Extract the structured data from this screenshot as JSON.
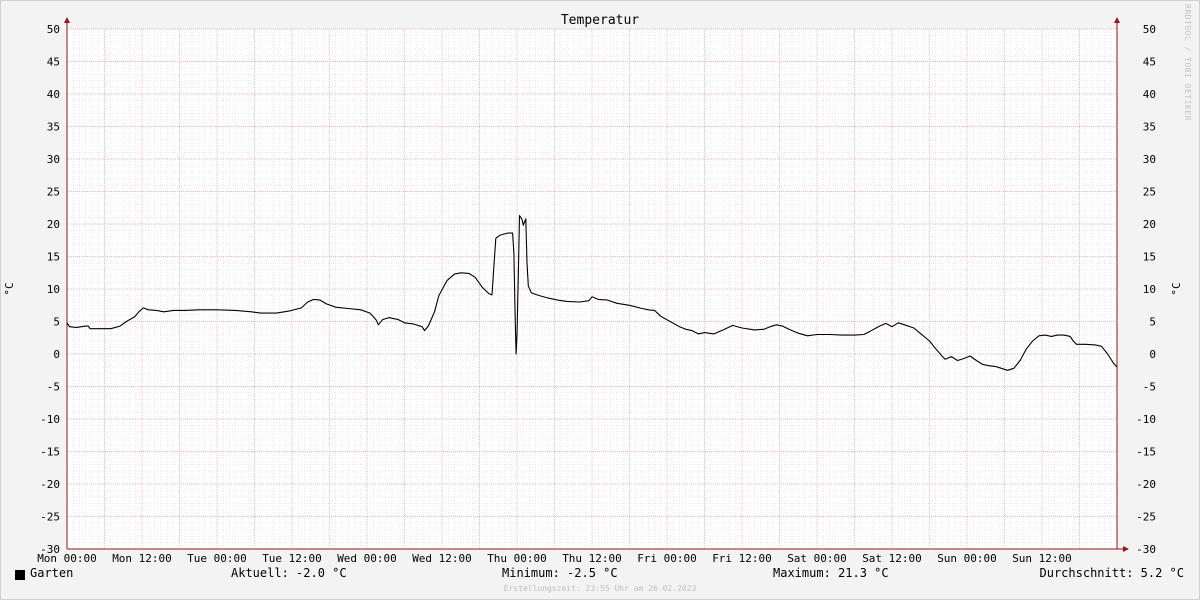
{
  "chart_data": {
    "type": "line",
    "title": "Temperatur",
    "ylabel": "°C",
    "ylim": [
      -30,
      50
    ],
    "yticks": [
      50,
      45,
      40,
      35,
      30,
      25,
      20,
      15,
      10,
      5,
      0,
      -5,
      -10,
      -15,
      -20,
      -25,
      -30
    ],
    "xlim": [
      0,
      168
    ],
    "xticks": [
      {
        "t": 0,
        "label": "Mon 00:00"
      },
      {
        "t": 12,
        "label": "Mon 12:00"
      },
      {
        "t": 24,
        "label": "Tue 00:00"
      },
      {
        "t": 36,
        "label": "Tue 12:00"
      },
      {
        "t": 48,
        "label": "Wed 00:00"
      },
      {
        "t": 60,
        "label": "Wed 12:00"
      },
      {
        "t": 72,
        "label": "Thu 00:00"
      },
      {
        "t": 84,
        "label": "Thu 12:00"
      },
      {
        "t": 96,
        "label": "Fri 00:00"
      },
      {
        "t": 108,
        "label": "Fri 12:00"
      },
      {
        "t": 120,
        "label": "Sat 00:00"
      },
      {
        "t": 132,
        "label": "Sat 12:00"
      },
      {
        "t": 144,
        "label": "Sun 00:00"
      },
      {
        "t": 156,
        "label": "Sun 12:00"
      }
    ],
    "series": [
      {
        "name": "Garten",
        "color": "#000000",
        "points": [
          [
            0,
            4.8
          ],
          [
            0.4,
            4.2
          ],
          [
            1.5,
            4.1
          ],
          [
            3,
            4.3
          ],
          [
            3.4,
            4.3
          ],
          [
            3.7,
            3.9
          ],
          [
            5,
            3.9
          ],
          [
            7,
            3.9
          ],
          [
            8.5,
            4.3
          ],
          [
            9.5,
            5.0
          ],
          [
            10.8,
            5.7
          ],
          [
            11.5,
            6.5
          ],
          [
            12.2,
            7.1
          ],
          [
            13,
            6.8
          ],
          [
            14.3,
            6.7
          ],
          [
            15.5,
            6.5
          ],
          [
            17,
            6.7
          ],
          [
            19,
            6.7
          ],
          [
            21,
            6.8
          ],
          [
            24,
            6.8
          ],
          [
            27,
            6.7
          ],
          [
            29.5,
            6.5
          ],
          [
            31,
            6.3
          ],
          [
            33.5,
            6.3
          ],
          [
            35.5,
            6.6
          ],
          [
            37.5,
            7.1
          ],
          [
            38.5,
            8.0
          ],
          [
            39.5,
            8.4
          ],
          [
            40.5,
            8.3
          ],
          [
            41.5,
            7.7
          ],
          [
            43,
            7.2
          ],
          [
            45,
            7.0
          ],
          [
            47,
            6.8
          ],
          [
            48.5,
            6.3
          ],
          [
            49.5,
            5.2
          ],
          [
            49.8,
            4.5
          ],
          [
            50.5,
            5.3
          ],
          [
            51.5,
            5.6
          ],
          [
            53,
            5.3
          ],
          [
            54,
            4.8
          ],
          [
            55.5,
            4.6
          ],
          [
            56.8,
            4.2
          ],
          [
            57.2,
            3.6
          ],
          [
            57.8,
            4.3
          ],
          [
            58.8,
            6.5
          ],
          [
            59.5,
            9.0
          ],
          [
            60.8,
            11.3
          ],
          [
            62,
            12.3
          ],
          [
            63,
            12.5
          ],
          [
            64.3,
            12.4
          ],
          [
            65.3,
            11.8
          ],
          [
            66.5,
            10.2
          ],
          [
            67.5,
            9.3
          ],
          [
            68,
            9.1
          ],
          [
            68.3,
            13.5
          ],
          [
            68.6,
            17.8
          ],
          [
            69.3,
            18.3
          ],
          [
            70.5,
            18.6
          ],
          [
            71.3,
            18.6
          ],
          [
            71.5,
            15.5
          ],
          [
            71.7,
            6.0
          ],
          [
            71.85,
            0.0
          ],
          [
            72,
            3.0
          ],
          [
            72.2,
            12.0
          ],
          [
            72.4,
            21.3
          ],
          [
            72.8,
            20.7
          ],
          [
            73,
            19.8
          ],
          [
            73.2,
            20.3
          ],
          [
            73.4,
            20.8
          ],
          [
            73.6,
            14.0
          ],
          [
            73.8,
            10.5
          ],
          [
            74.3,
            9.4
          ],
          [
            75.5,
            9.0
          ],
          [
            77,
            8.6
          ],
          [
            78.5,
            8.3
          ],
          [
            80,
            8.1
          ],
          [
            82,
            8.0
          ],
          [
            83.5,
            8.2
          ],
          [
            84,
            8.8
          ],
          [
            85,
            8.4
          ],
          [
            86.5,
            8.3
          ],
          [
            88,
            7.8
          ],
          [
            90,
            7.5
          ],
          [
            92,
            7.0
          ],
          [
            93,
            6.8
          ],
          [
            94,
            6.7
          ],
          [
            95,
            5.8
          ],
          [
            96.5,
            5.0
          ],
          [
            98,
            4.2
          ],
          [
            99,
            3.8
          ],
          [
            100,
            3.6
          ],
          [
            101,
            3.1
          ],
          [
            102,
            3.3
          ],
          [
            103.5,
            3.1
          ],
          [
            105,
            3.7
          ],
          [
            106.5,
            4.4
          ],
          [
            108,
            4.0
          ],
          [
            110,
            3.7
          ],
          [
            111.5,
            3.8
          ],
          [
            112.5,
            4.2
          ],
          [
            113.5,
            4.5
          ],
          [
            114.5,
            4.3
          ],
          [
            115.5,
            3.8
          ],
          [
            117,
            3.2
          ],
          [
            118.5,
            2.8
          ],
          [
            120,
            3.0
          ],
          [
            122,
            3.0
          ],
          [
            124,
            2.9
          ],
          [
            126,
            2.9
          ],
          [
            127.5,
            3.0
          ],
          [
            128.5,
            3.5
          ],
          [
            130,
            4.3
          ],
          [
            131,
            4.7
          ],
          [
            132,
            4.2
          ],
          [
            133,
            4.8
          ],
          [
            134,
            4.5
          ],
          [
            135.5,
            4.0
          ],
          [
            136.5,
            3.2
          ],
          [
            138,
            2.0
          ],
          [
            139,
            0.8
          ],
          [
            140,
            -0.3
          ],
          [
            140.5,
            -0.8
          ],
          [
            141.5,
            -0.4
          ],
          [
            142.5,
            -1.0
          ],
          [
            143.5,
            -0.7
          ],
          [
            144.5,
            -0.3
          ],
          [
            145.5,
            -1.0
          ],
          [
            146.5,
            -1.6
          ],
          [
            147.5,
            -1.8
          ],
          [
            148.5,
            -1.9
          ],
          [
            149.5,
            -2.2
          ],
          [
            150.5,
            -2.5
          ],
          [
            151.5,
            -2.2
          ],
          [
            152.5,
            -1.0
          ],
          [
            153.5,
            0.8
          ],
          [
            154.5,
            2.0
          ],
          [
            155.5,
            2.8
          ],
          [
            156.5,
            2.9
          ],
          [
            157.5,
            2.7
          ],
          [
            158.5,
            2.9
          ],
          [
            159.5,
            2.9
          ],
          [
            160.5,
            2.7
          ],
          [
            161,
            2.0
          ],
          [
            161.5,
            1.5
          ],
          [
            163,
            1.5
          ],
          [
            164.5,
            1.4
          ],
          [
            165.5,
            1.2
          ],
          [
            166.5,
            0.0
          ],
          [
            167.5,
            -1.5
          ],
          [
            168,
            -2.0
          ]
        ]
      }
    ],
    "grid": true,
    "legend": "bottom"
  },
  "legend": {
    "series_name": "Garten",
    "current": "Aktuell: -2.0 °C",
    "minimum": "Minimum: -2.5 °C",
    "maximum": "Maximum: 21.3 °C",
    "average": "Durchschnitt: 5.2 °C"
  },
  "footer_note": "Erstellungszeit: 23:55 Uhr am 26.02.2023",
  "watermark": "RRDTOOL / TOBI OETIKER",
  "colors": {
    "background": "#f3f3f3",
    "plot_area": "#ffffff",
    "major_grid": "#e8a0a8",
    "minor_grid": "#cfcfcf",
    "axis": "#8b1a1a",
    "series": "#000000"
  }
}
